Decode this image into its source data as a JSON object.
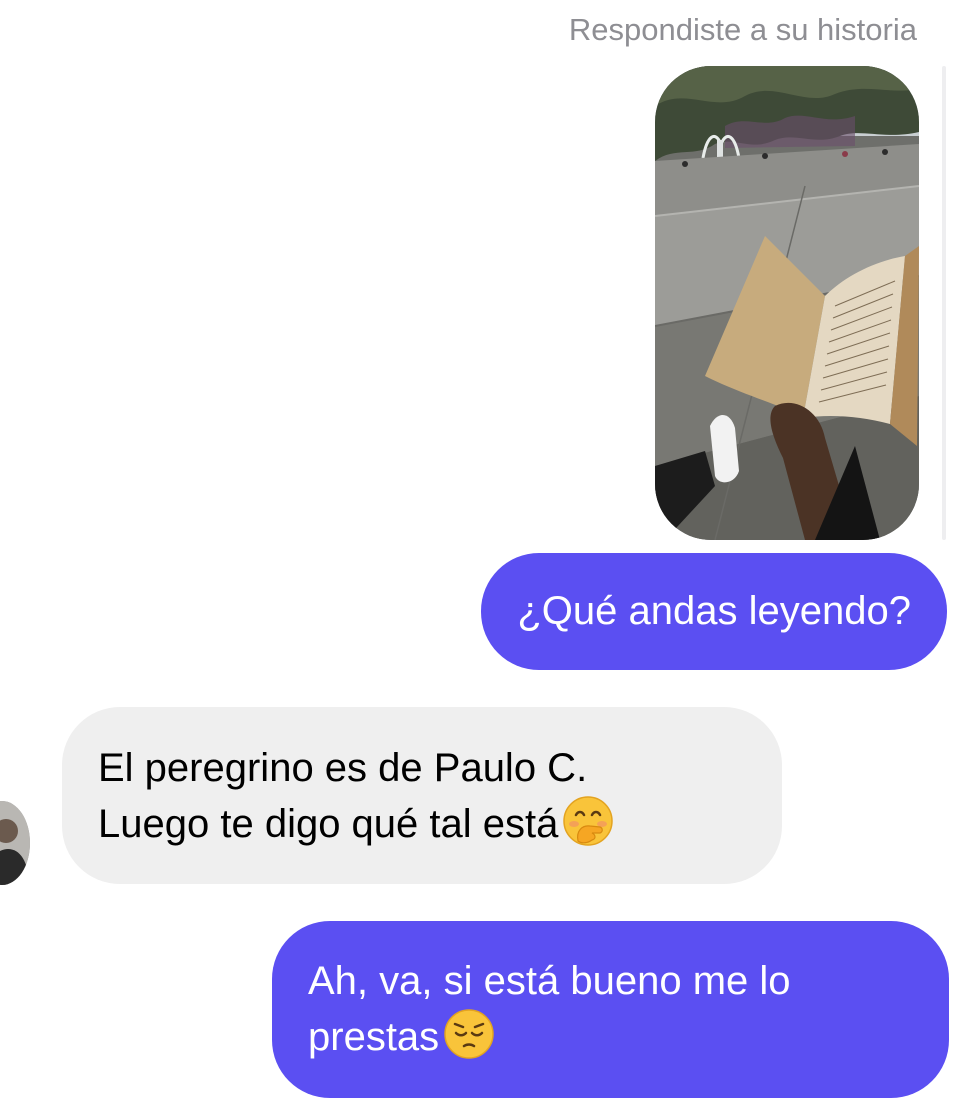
{
  "story": {
    "caption": "Respondiste a su historia",
    "thumbnail_icon": "story-photo-reading-book-in-plaza"
  },
  "messages": [
    {
      "direction": "outgoing",
      "lines": [
        "¿Qué andas leyendo?"
      ]
    },
    {
      "direction": "incoming",
      "lines": [
        "El peregrino es de Paulo C.",
        "Luego te digo qué tal está"
      ],
      "emoji": "face-with-hand-over-mouth-icon"
    },
    {
      "direction": "outgoing",
      "lines": [
        "Ah, va, si está bueno me lo",
        "prestas"
      ],
      "emoji": "pensive-face-icon"
    }
  ],
  "contact": {
    "avatar_icon": "contact-avatar"
  },
  "colors": {
    "outgoing_bubble": "#5b4ff2",
    "incoming_bubble": "#efefef",
    "caption_text": "#8e8e93",
    "background": "#ffffff"
  }
}
